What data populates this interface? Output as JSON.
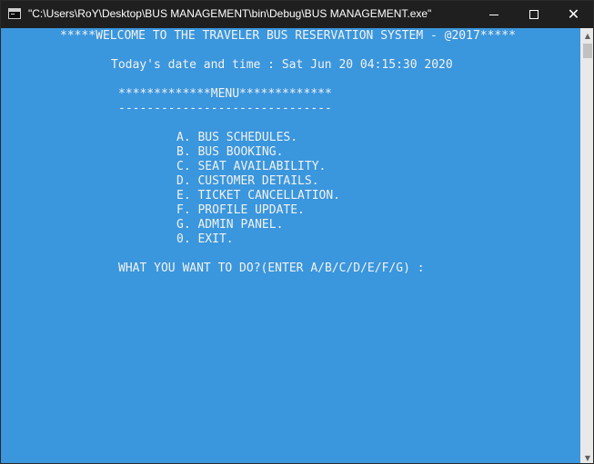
{
  "window": {
    "title": "\"C:\\Users\\RoY\\Desktop\\BUS MANAGEMENT\\bin\\Debug\\BUS MANAGEMENT.exe\""
  },
  "console": {
    "welcome": "*****WELCOME TO THE TRAVELER BUS RESERVATION SYSTEM - @2017*****",
    "datetime": "Today's date and time : Sat Jun 20 04:15:30 2020",
    "menu_header": "*************MENU*************",
    "separator": "------------------------------",
    "options": [
      "A. BUS SCHEDULES.",
      "B. BUS BOOKING.",
      "C. SEAT AVAILABILITY.",
      "D. CUSTOMER DETAILS.",
      "E. TICKET CANCELLATION.",
      "F. PROFILE UPDATE.",
      "G. ADMIN PANEL.",
      "0. EXIT."
    ],
    "prompt": "WHAT YOU WANT TO DO?(ENTER A/B/C/D/E/F/G) :"
  },
  "colors": {
    "console_bg": "#3a96dd",
    "titlebar_bg": "#1f1f1f",
    "text": "#f2f2f2"
  }
}
